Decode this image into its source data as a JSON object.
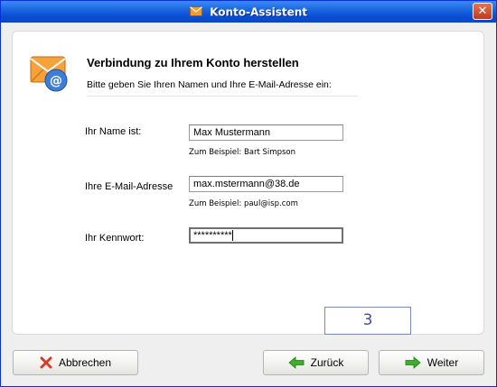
{
  "window": {
    "title": "Konto-Assistent"
  },
  "header": {
    "title": "Verbindung zu Ihrem Konto herstellen",
    "subtitle": "Bitte geben Sie Ihren Namen und Ihre E-Mail-Adresse ein:"
  },
  "form": {
    "name": {
      "label": "Ihr Name ist:",
      "value": "Max Mustermann",
      "hint": "Zum Beispiel: Bart Simpson"
    },
    "email": {
      "label": "Ihre E-Mail-Adresse",
      "value": "max.mstermann@38.de",
      "hint": "Zum Beispiel: paul@isp.com"
    },
    "password": {
      "label": "Ihr Kennwort:",
      "value": "**********"
    }
  },
  "step_indicator": "3",
  "buttons": {
    "cancel": "Abbrechen",
    "back": "Zurück",
    "next": "Weiter"
  },
  "icons": {
    "title": "envelope-icon",
    "header": "envelope-at-icon",
    "cancel": "red-x-icon",
    "back": "green-arrow-left-icon",
    "next": "green-arrow-right-icon"
  },
  "colors": {
    "titlebar": "#0a4fd4",
    "accent_green": "#3fae2a",
    "cancel_red": "#d63a2a"
  }
}
